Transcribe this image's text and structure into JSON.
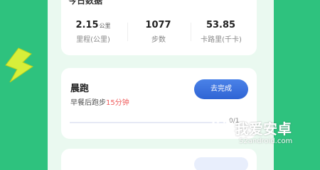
{
  "colors": {
    "background": "#2ec27e",
    "panel": "#eaf9f0",
    "accent_blue": "#3a6fdc",
    "highlight_red": "#ef5a5a",
    "bolt_yellow": "#d7ef3a"
  },
  "today_stats": {
    "title": "今日数据",
    "items": [
      {
        "value": "2.15",
        "unit": "公里",
        "label": "里程(公里)"
      },
      {
        "value": "1077",
        "unit": "",
        "label": "步数"
      },
      {
        "value": "53.85",
        "unit": "",
        "label": "卡路里(千卡)"
      }
    ]
  },
  "task": {
    "title": "晨跑",
    "desc_prefix": "早餐后跑步",
    "desc_highlight": "15分钟",
    "button_label": "去完成",
    "progress_text": "0/1",
    "progress_fraction": 0
  },
  "watermark": {
    "brand": "我爱安卓",
    "url": "52android.com",
    "icon": "android-logo-icon"
  },
  "decoration": {
    "icon": "lightning-bolt-icon"
  }
}
